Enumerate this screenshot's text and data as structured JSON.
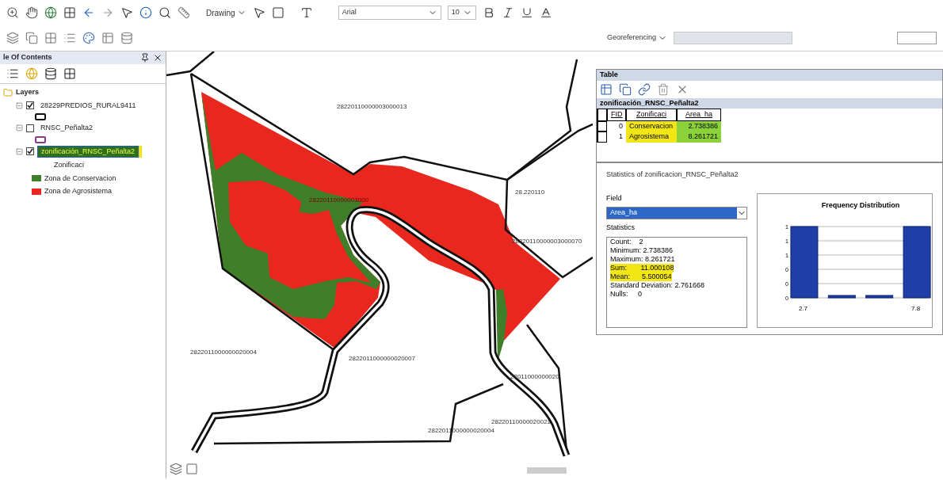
{
  "toolbar": {
    "drawing_menu": "Drawing",
    "font_name": "Arial",
    "font_size": "10",
    "georeferencing_menu": "Georeferencing"
  },
  "toc": {
    "title": "le Of Contents",
    "root": "Layers",
    "layers": [
      {
        "name": "28229PREDIOS_RURAL9411",
        "checked": true,
        "selected": false
      },
      {
        "name": "RNSC_Peñalta2",
        "checked": false,
        "selected": false
      },
      {
        "name": "zonificación_RNSC_Peñalta2",
        "checked": true,
        "selected": true,
        "field": "Zonificaci",
        "legend": [
          {
            "label": "Zona de Conservacion",
            "color": "#3f7f2a"
          },
          {
            "label": "Zona de Agrosistema",
            "color": "#e8281e"
          }
        ]
      }
    ]
  },
  "map": {
    "labels": [
      {
        "text": "28220110000003000013",
        "highlighted": false
      },
      {
        "text": "28220110000003000",
        "highlighted": true
      },
      {
        "text": "28.220110",
        "highlighted": false
      },
      {
        "text": "28220110000003000070",
        "highlighted": false
      },
      {
        "text": "2822011000000020004",
        "highlighted": false
      },
      {
        "text": "2822011000000020007",
        "highlighted": false
      },
      {
        "text": "22011000000020",
        "highlighted": false
      },
      {
        "text": "28220110000020021",
        "highlighted": false
      },
      {
        "text": "2822011000000020004",
        "highlighted": false
      }
    ]
  },
  "table": {
    "title": "Table",
    "tab": "zonificación_RNSC_Peñalta2",
    "columns": [
      "FID",
      "Zonificaci",
      "Area_ha"
    ],
    "rows": [
      {
        "cells": [
          "0",
          "Conservacion",
          "2.738386"
        ],
        "highlighted": true
      },
      {
        "cells": [
          "1",
          "Agrosistema",
          "8.261721"
        ],
        "highlighted": true
      }
    ]
  },
  "statistics": {
    "title": "Statistics of zonificacion_RNSC_Peñalta2",
    "field_label": "Field",
    "field_value": "Area_ha",
    "stats_label": "Statistics",
    "lines": [
      {
        "text": "Count:    2",
        "highlighted": false
      },
      {
        "text": "Minimum: 2.738386",
        "highlighted": false
      },
      {
        "text": "Maximum: 8.261721",
        "highlighted": false
      },
      {
        "text": "Sum:       11.000108",
        "highlighted": true
      },
      {
        "text": "Mean:      5.500054",
        "highlighted": true
      },
      {
        "text": "Standard Deviation: 2.761668",
        "highlighted": false
      },
      {
        "text": "Nulls:     0",
        "highlighted": false
      }
    ],
    "chart_data": {
      "type": "bar",
      "title": "Frequency Distribution",
      "values": [
        1,
        0,
        0,
        1
      ],
      "x": [
        2.7,
        4.4,
        6.1,
        7.8
      ],
      "xticks": [
        2.7,
        7.8
      ],
      "xlim": [
        2.2,
        8.3
      ],
      "grid": true,
      "yticks": [
        {
          "value": 1,
          "label": "1"
        },
        {
          "value": 0.8,
          "label": "1"
        },
        {
          "value": 0.6,
          "label": "1"
        },
        {
          "value": 0.4,
          "label": "0"
        },
        {
          "value": 0.2,
          "label": "0"
        },
        {
          "value": 0,
          "label": "0"
        }
      ],
      "ylim": [
        0,
        1
      ]
    }
  }
}
